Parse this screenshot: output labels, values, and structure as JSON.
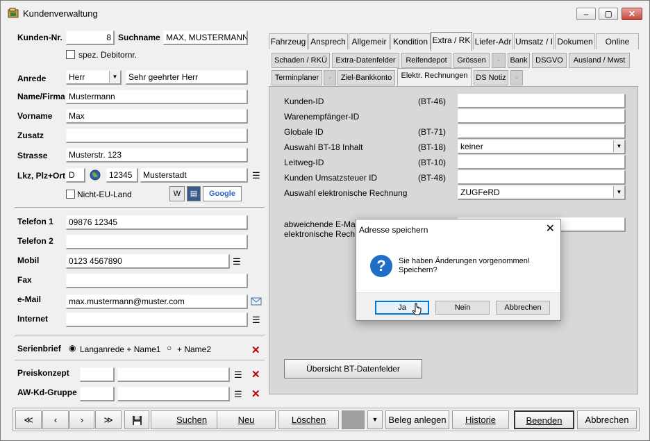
{
  "window": {
    "title": "Kundenverwaltung",
    "minimize": "–",
    "maximize": "▢",
    "close": "✕"
  },
  "customer": {
    "kundennr_label": "Kunden-Nr.",
    "kundennr_value": "8",
    "suchname_label": "Suchname",
    "suchname_value": "MAX, MUSTERMANN",
    "spez_debitor_label": "spez. Debitornr.",
    "anrede_label": "Anrede",
    "anrede_value": "Herr",
    "anrede_text": "Sehr geehrter Herr",
    "name_label": "Name/Firma",
    "name_value": "Mustermann",
    "vorname_label": "Vorname",
    "vorname_value": "Max",
    "zusatz_label": "Zusatz",
    "zusatz_value": "",
    "strasse_label": "Strasse",
    "strasse_value": "Musterstr. 123",
    "lkz_label": "Lkz, Plz+Ort",
    "lkz_value": "D",
    "plz_value": "12345",
    "ort_value": "Musterstadt",
    "nicht_eu_label": "Nicht-EU-Land",
    "google_label": "Google"
  },
  "contact": {
    "telefon1_label": "Telefon 1",
    "telefon1_value": "09876 12345",
    "telefon2_label": "Telefon 2",
    "telefon2_value": "",
    "mobil_label": "Mobil",
    "mobil_value": "0123 4567890",
    "fax_label": "Fax",
    "fax_value": "",
    "email_label": "e-Mail",
    "email_value": "max.mustermann@muster.com",
    "internet_label": "Internet",
    "internet_value": ""
  },
  "serienbrief": {
    "label": "Serienbrief",
    "option1": "Langanrede + Name1",
    "option2": "+ Name2"
  },
  "preis": {
    "preiskonzept_label": "Preiskonzept",
    "awkd_label": "AW-Kd-Gruppe"
  },
  "tabs_row1": [
    "Fahrzeug",
    "Ansprech",
    "Allgemeir",
    "Kondition",
    "Extra / RK",
    "Liefer-Adr",
    "Umsatz / I",
    "Dokumen",
    "Online"
  ],
  "tabs_row2": [
    "Schaden / RKÜ",
    "Extra-Datenfelder",
    "Reifendepot",
    "Grössen",
    "-",
    "Bank",
    "DSGVO",
    "Ausland / Mwst"
  ],
  "tabs_row3": [
    "Terminplaner",
    "-",
    "Ziel-Bankkonto",
    "Elektr. Rechnungen",
    "DS Notiz",
    "-"
  ],
  "erechnung": {
    "rows": [
      {
        "label": "Kunden-ID",
        "code": "(BT-46)",
        "value": ""
      },
      {
        "label": "Warenempfänger-ID",
        "code": "",
        "value": ""
      },
      {
        "label": "Globale ID",
        "code": "(BT-71)",
        "value": ""
      },
      {
        "label": "Auswahl BT-18 Inhalt",
        "code": "(BT-18)",
        "value": "keiner"
      },
      {
        "label": "Leitweg-ID",
        "code": "(BT-10)",
        "value": ""
      },
      {
        "label": "Kunden Umsatzsteuer ID",
        "code": "(BT-48)",
        "value": ""
      },
      {
        "label": "Auswahl  elektronische Rechnung",
        "code": "",
        "value": "ZUGFeRD"
      }
    ],
    "email_label_1": "abweichende E-Ma",
    "email_label_2": "elektronische Rech",
    "overview_button": "Übersicht BT-Datenfelder"
  },
  "toolbar": {
    "suchen": "Suchen",
    "neu": "Neu",
    "loeschen": "Löschen",
    "beleg": "Beleg anlegen",
    "historie": "Historie",
    "beenden": "Beenden",
    "abbrechen": "Abbrechen"
  },
  "dialog": {
    "title": "Adresse speichern",
    "message_line1": "Sie haben Änderungen vorgenommen!",
    "message_line2": "Speichern?",
    "yes": "Ja",
    "no": "Nein",
    "cancel": "Abbrechen"
  }
}
